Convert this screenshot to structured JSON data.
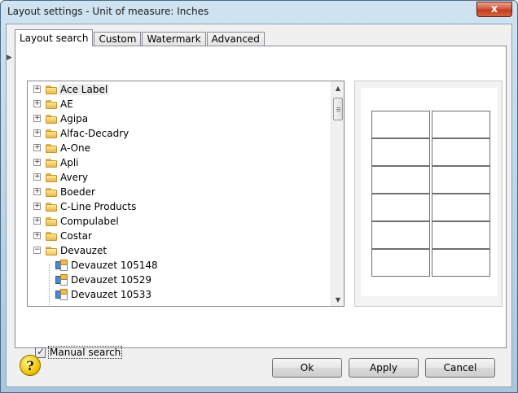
{
  "window": {
    "title": "Layout settings - Unit of measure: Inches",
    "close_label": "x"
  },
  "tabs": [
    {
      "label": "Layout search",
      "active": true
    },
    {
      "label": "Custom",
      "active": false
    },
    {
      "label": "Watermark",
      "active": false
    },
    {
      "label": "Advanced",
      "active": false
    }
  ],
  "tree": {
    "nodes": [
      {
        "label": "Ace Label",
        "type": "folder",
        "expanded": false,
        "selected": true
      },
      {
        "label": "AE",
        "type": "folder",
        "expanded": false
      },
      {
        "label": "Agipa",
        "type": "folder",
        "expanded": false
      },
      {
        "label": "Alfac-Decadry",
        "type": "folder",
        "expanded": false
      },
      {
        "label": "A-One",
        "type": "folder",
        "expanded": false
      },
      {
        "label": "Apli",
        "type": "folder",
        "expanded": false
      },
      {
        "label": "Avery",
        "type": "folder",
        "expanded": false
      },
      {
        "label": "Boeder",
        "type": "folder",
        "expanded": false
      },
      {
        "label": "C-Line Products",
        "type": "folder",
        "expanded": false
      },
      {
        "label": "Compulabel",
        "type": "folder",
        "expanded": false
      },
      {
        "label": "Costar",
        "type": "folder",
        "expanded": false
      },
      {
        "label": "Devauzet",
        "type": "folder",
        "expanded": true
      },
      {
        "label": "Devauzet 105148",
        "type": "layout"
      },
      {
        "label": "Devauzet 10529",
        "type": "layout"
      },
      {
        "label": "Devauzet 10533",
        "type": "layout"
      }
    ]
  },
  "preview": {
    "columns": 2,
    "rows": 6
  },
  "manual_search": {
    "label": "Manual search",
    "checked": true
  },
  "buttons": {
    "ok": "Ok",
    "apply": "Apply",
    "cancel": "Cancel"
  },
  "help": {
    "glyph": "?"
  },
  "icons": {
    "expand": "plus-box-icon",
    "collapse": "minus-box-icon",
    "folder": "folder-icon",
    "layout": "label-layout-icon"
  },
  "colors": {
    "title_bar": "#b9d3e6",
    "close_button": "#c43b1f",
    "folder": "#e8b74d"
  }
}
